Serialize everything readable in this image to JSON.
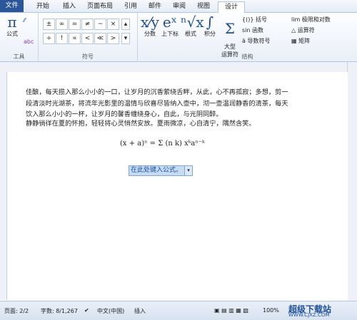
{
  "tabs": {
    "file": "文件",
    "items": [
      "开始",
      "插入",
      "页面布局",
      "引用",
      "邮件",
      "审阅",
      "视图",
      "设计"
    ]
  },
  "ribbon": {
    "tools": {
      "formula": "公式",
      "label": "工具",
      "abc": "abc"
    },
    "symbols": {
      "label": "符号",
      "row1": [
        "±",
        "∞",
        "=",
        "≠",
        "~",
        "×"
      ],
      "row2": [
        "÷",
        "!",
        "∝",
        "<",
        "≪",
        ">"
      ]
    },
    "structures": {
      "label": "结构",
      "fraction": "分数",
      "script": "上下标",
      "radical": "根式",
      "integral": "积分",
      "large_operator": "大型\n运算符",
      "bracket": "括号",
      "function": "函数",
      "accent": "导数符号",
      "limit": "极限和对数",
      "operator": "运算符",
      "matrix": "矩阵"
    }
  },
  "document": {
    "para1": [
      "佳酿，每天揽入那么小小的一口，让岁月的沉香萦绕舌畔，从此，心不再孤寂；多想，剪一",
      "段清淡时光湖茶，将流年光影里的温情与欣喜尽皆纳入壶中，沏一壶温润静香的清茶，每天",
      "饮入那么小小的一杯，让岁月的馨香缠绕身心，自此，与光阴同醉。"
    ],
    "para2": "静静徜徉在夏的怀抱，轻轻将心灵悄然安放。夏雨微凉，心自清宁，隅然含笑。",
    "equation": "(x + a)ⁿ = Σ (n k) xᵏaⁿ⁻ᵏ",
    "placeholder": "在此处键入公式。"
  },
  "status": {
    "page": "页面: 2/2",
    "words": "字数: 8/1,267",
    "language": "中文(中国)",
    "mode": "插入",
    "zoom": "100%",
    "watermark": "超级下载站",
    "watermark_url": "WWW.CJXZ.COM"
  }
}
